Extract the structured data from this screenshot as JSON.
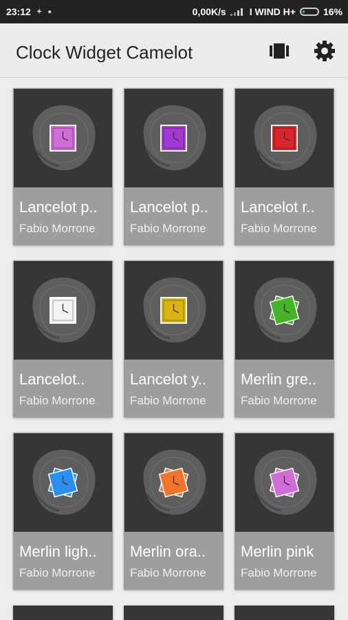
{
  "status_bar": {
    "time": "23:12",
    "speed": "0,00K/s",
    "carrier": "I WIND H+",
    "battery": "16%",
    "battery_level": 0.16,
    "battery_color": "#49c23e"
  },
  "app_bar": {
    "title": "Clock Widget Camelot",
    "icons": [
      "view-carousel-icon",
      "gear-icon"
    ]
  },
  "widgets": [
    {
      "name": "Lancelot p..",
      "author": "Fabio Morrone",
      "color": "#d06cd6",
      "shape": "square"
    },
    {
      "name": "Lancelot p..",
      "author": "Fabio Morrone",
      "color": "#a23ad2",
      "shape": "square"
    },
    {
      "name": "Lancelot r..",
      "author": "Fabio Morrone",
      "color": "#d8262a",
      "shape": "square"
    },
    {
      "name": "Lancelot..",
      "author": "Fabio Morrone",
      "color": "#f2f2f2",
      "shape": "square"
    },
    {
      "name": "Lancelot y..",
      "author": "Fabio Morrone",
      "color": "#d9b512",
      "shape": "square"
    },
    {
      "name": "Merlin gre..",
      "author": "Fabio Morrone",
      "color": "#46b428",
      "shape": "flower"
    },
    {
      "name": "Merlin ligh..",
      "author": "Fabio Morrone",
      "color": "#2a8ef0",
      "shape": "flower"
    },
    {
      "name": "Merlin ora..",
      "author": "Fabio Morrone",
      "color": "#f2742a",
      "shape": "flower"
    },
    {
      "name": "Merlin pink",
      "author": "Fabio Morrone",
      "color": "#d06cd6",
      "shape": "flower"
    }
  ]
}
